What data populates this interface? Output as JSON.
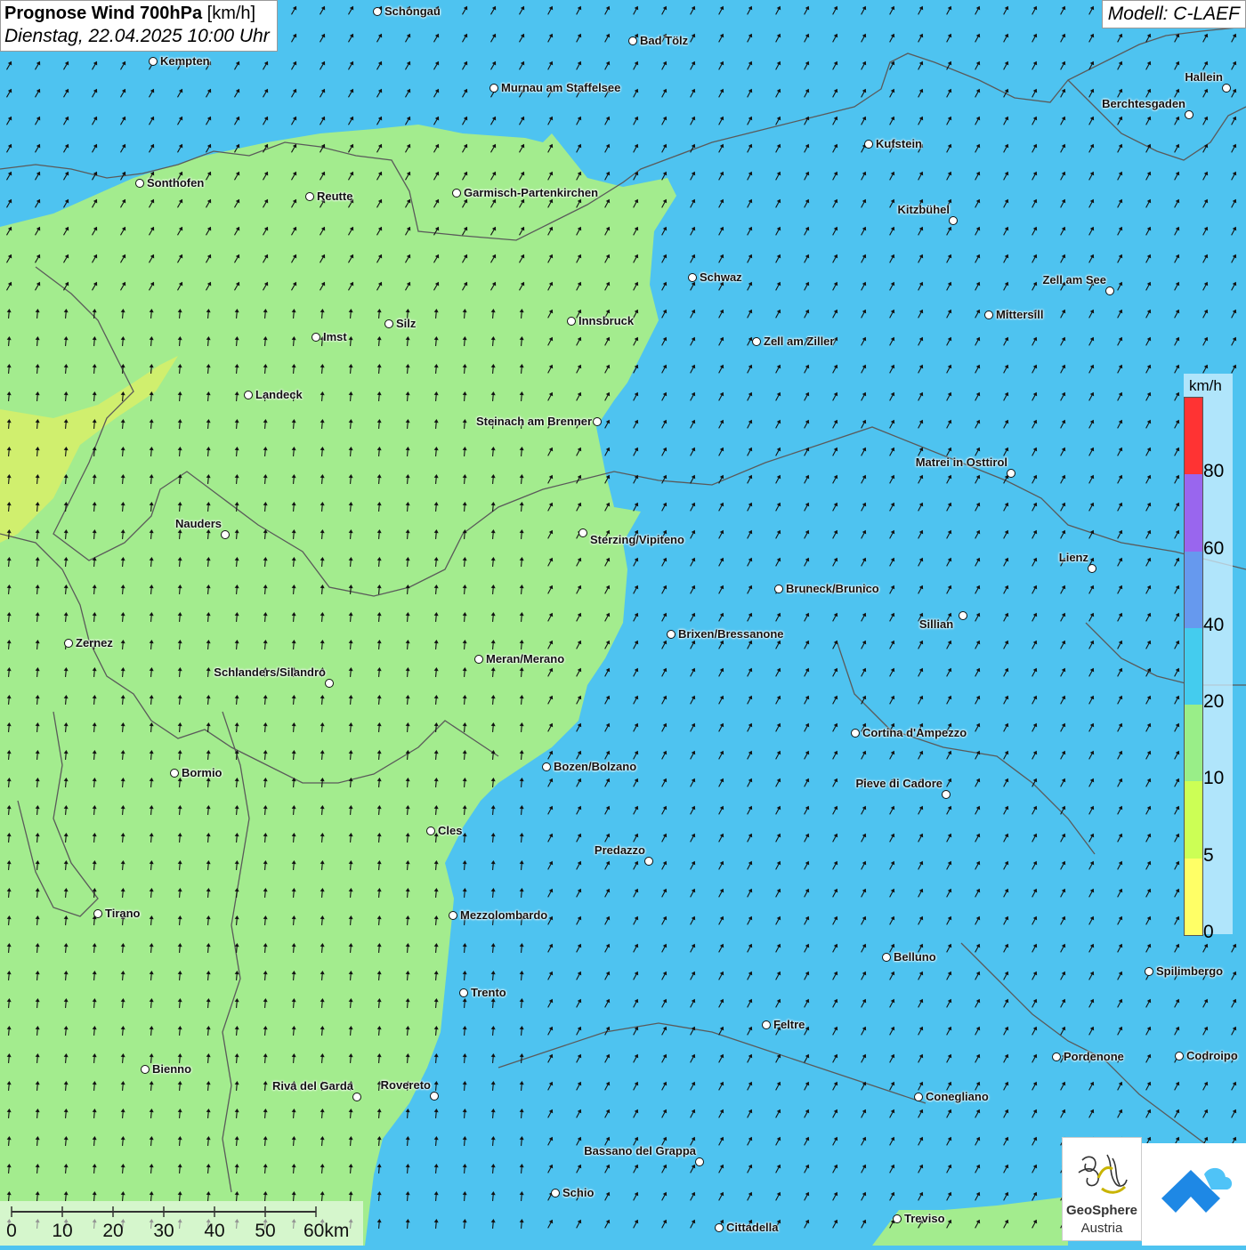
{
  "title": {
    "main": "Prognose Wind 700hPa",
    "unit": "[km/h]",
    "datetime": "Dienstag, 22.04.2025 10:00 Uhr"
  },
  "model": "Modell: C-LAEF",
  "legend": {
    "unit": "km/h",
    "ticks": [
      "0",
      "5",
      "10",
      "20",
      "40",
      "60",
      "80"
    ],
    "colors": [
      "#ffff66",
      "#ccff55",
      "#99ee88",
      "#44ccee",
      "#6699ee",
      "#9966ee",
      "#ff3333"
    ]
  },
  "colors": {
    "wind_low": "#a3ec8e",
    "wind_mid": "#4ec3f0",
    "wind_yellow": "#d5ef6a",
    "arrow": "#111111",
    "border": "#5a5a5a"
  },
  "cities": [
    {
      "name": "Schongau"
    },
    {
      "name": "Bad Tölz"
    },
    {
      "name": "Kempten"
    },
    {
      "name": "Murnau am Staffelsee"
    },
    {
      "name": "Hallein"
    },
    {
      "name": "Berchtesgaden"
    },
    {
      "name": "Kufstein"
    },
    {
      "name": "Sonthofen"
    },
    {
      "name": "Reutte"
    },
    {
      "name": "Garmisch-Partenkirchen"
    },
    {
      "name": "Kitzbühel"
    },
    {
      "name": "Schwaz"
    },
    {
      "name": "Zell am See"
    },
    {
      "name": "Mittersill"
    },
    {
      "name": "Innsbruck"
    },
    {
      "name": "Silz"
    },
    {
      "name": "Imst"
    },
    {
      "name": "Zell am Ziller"
    },
    {
      "name": "Landeck"
    },
    {
      "name": "Steinach am Brenner"
    },
    {
      "name": "Matrei in Osttirol"
    },
    {
      "name": "Nauders"
    },
    {
      "name": "Sterzing/Vipiteno"
    },
    {
      "name": "Lienz"
    },
    {
      "name": "Bruneck/Brunico"
    },
    {
      "name": "Sillian"
    },
    {
      "name": "Zernez"
    },
    {
      "name": "Brixen/Bressanone"
    },
    {
      "name": "Meran/Merano"
    },
    {
      "name": "Schlanders/Silandro"
    },
    {
      "name": "Cortina d'Ampezzo"
    },
    {
      "name": "Bozen/Bolzano"
    },
    {
      "name": "Bormio"
    },
    {
      "name": "Pieve di Cadore"
    },
    {
      "name": "Cles"
    },
    {
      "name": "Predazzo"
    },
    {
      "name": "Tirano"
    },
    {
      "name": "Mezzolombardo"
    },
    {
      "name": "Belluno"
    },
    {
      "name": "Spilimbergo"
    },
    {
      "name": "Trento"
    },
    {
      "name": "Feltre"
    },
    {
      "name": "Pordenone"
    },
    {
      "name": "Codroipo"
    },
    {
      "name": "Bienno"
    },
    {
      "name": "Riva del Garda"
    },
    {
      "name": "Rovereto"
    },
    {
      "name": "Conegliano"
    },
    {
      "name": "Bassano del Grappa"
    },
    {
      "name": "Schio"
    },
    {
      "name": "Treviso"
    },
    {
      "name": "Cittadella"
    }
  ],
  "scale": {
    "labels": [
      "0",
      "10",
      "20",
      "30",
      "40",
      "50",
      "60km"
    ]
  },
  "logo": {
    "line1": "GeoSphere",
    "line2": "Austria"
  }
}
